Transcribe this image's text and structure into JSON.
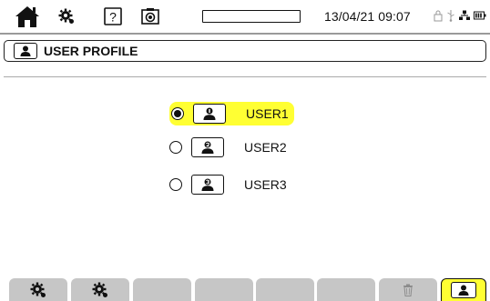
{
  "topbar": {
    "icons": [
      "home-icon",
      "gear-icon",
      "help-icon",
      "camera-icon"
    ],
    "help_glyph": "?",
    "progress_fraction": 0.0,
    "datetime": "13/04/21 09:07",
    "status_icons": [
      "lock-icon",
      "usb-icon",
      "network-icon",
      "battery-icon"
    ]
  },
  "title": {
    "icon": "user-profile-icon",
    "text": "USER PROFILE"
  },
  "users": [
    {
      "label": "USER1",
      "selected": true,
      "icon": "user-icon"
    },
    {
      "label": "USER2",
      "selected": false,
      "icon": "user-icon"
    },
    {
      "label": "USER3",
      "selected": false,
      "icon": "user-icon"
    }
  ],
  "bottom_tabs": [
    {
      "icon": "gear-icon",
      "active": false
    },
    {
      "icon": "gear-icon",
      "active": false
    },
    {
      "icon": "",
      "active": false
    },
    {
      "icon": "",
      "active": false
    },
    {
      "icon": "",
      "active": false
    },
    {
      "icon": "",
      "active": false
    },
    {
      "icon": "trash-icon",
      "active": false
    },
    {
      "icon": "user-profile-icon",
      "active": true
    }
  ],
  "colors": {
    "highlight": "#ffff33",
    "tab_gray": "#c6c6c6",
    "text": "#111111"
  }
}
